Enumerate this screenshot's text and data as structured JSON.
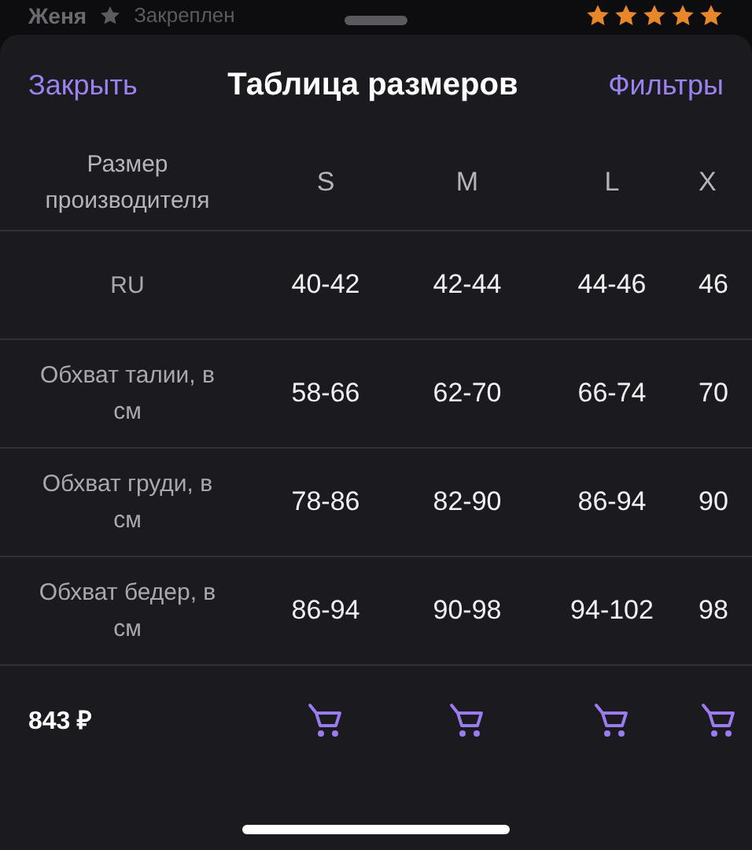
{
  "background_review": {
    "author": "Женя",
    "pinned": "Закреплен",
    "stars": 5
  },
  "sheet": {
    "close": "Закрыть",
    "title": "Таблица размеров",
    "filters": "Фильтры"
  },
  "table": {
    "header_label": "Размер производителя",
    "columns": [
      "S",
      "M",
      "L",
      "X"
    ],
    "rows": [
      {
        "label": "RU",
        "values": [
          "40-42",
          "42-44",
          "44-46",
          "46"
        ]
      },
      {
        "label": "Обхват талии, в см",
        "values": [
          "58-66",
          "62-70",
          "66-74",
          "70"
        ]
      },
      {
        "label": "Обхват груди, в см",
        "values": [
          "78-86",
          "82-90",
          "86-94",
          "90"
        ]
      },
      {
        "label": "Обхват бедер, в см",
        "values": [
          "86-94",
          "90-98",
          "94-102",
          "98"
        ]
      }
    ]
  },
  "footer": {
    "price": "843 ₽"
  }
}
